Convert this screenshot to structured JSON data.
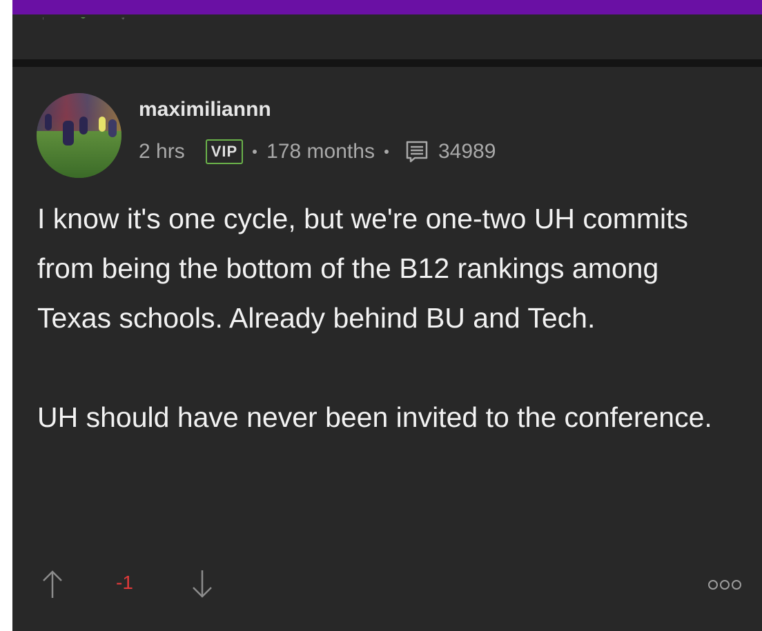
{
  "post": {
    "author": "maximiliannn",
    "time": "2 hrs",
    "badge": "VIP",
    "tenure": "178 months",
    "message_count": "34989",
    "body": [
      "I know it's one cycle, but we're one-two UH commits from being the bottom of the B12 rankings among Texas schools. Already behind BU and Tech.",
      "UH should have never been invited to the conference."
    ],
    "score": "-1"
  },
  "icons": {
    "upvote": "arrow-up-icon",
    "downvote": "arrow-down-icon",
    "messages": "message-list-icon",
    "more": "more-options-icon"
  },
  "colors": {
    "background": "#282828",
    "accent_bar": "#6a10a4",
    "vip_border": "#6ab24a",
    "negative_score": "#e03a3a",
    "text": "#f2f2f2",
    "meta_text": "#a9a9a9"
  }
}
